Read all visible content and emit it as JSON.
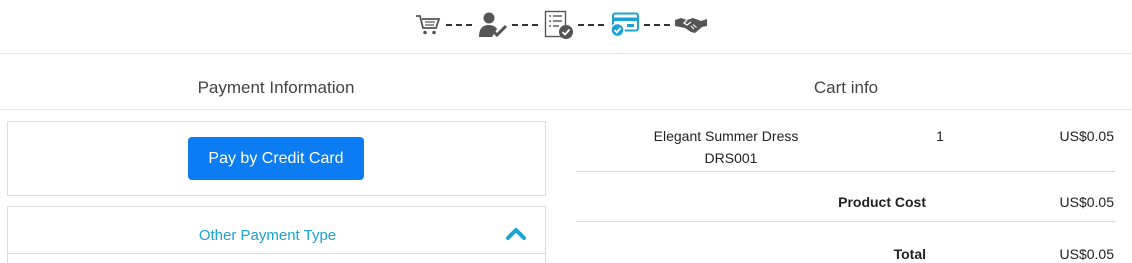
{
  "progress": {
    "steps": [
      {
        "icon": "cart-icon",
        "state": "done"
      },
      {
        "icon": "user-check-icon",
        "state": "done"
      },
      {
        "icon": "checklist-icon",
        "state": "done"
      },
      {
        "icon": "credit-card-icon",
        "state": "active"
      },
      {
        "icon": "handshake-icon",
        "state": "pending"
      }
    ],
    "active_color": "#1aa3d4",
    "done_color": "#555555"
  },
  "payment": {
    "title": "Payment Information",
    "credit_card_button": "Pay by Credit Card",
    "other_payment_label": "Other Payment Type",
    "button_color": "#0b7cf2"
  },
  "cart": {
    "title": "Cart info",
    "items": [
      {
        "name": "Elegant Summer Dress",
        "sku": "DRS001",
        "quantity": "1",
        "price": "US$0.05"
      }
    ],
    "product_cost_label": "Product Cost",
    "product_cost": "US$0.05",
    "total_label": "Total",
    "total": "US$0.05"
  }
}
